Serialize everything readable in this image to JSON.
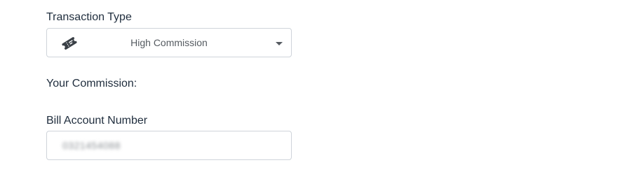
{
  "form": {
    "transaction_type": {
      "label": "Transaction Type",
      "selected": "High Commission",
      "icon": "ticket-icon"
    },
    "commission": {
      "label": "Your Commission:"
    },
    "bill_account": {
      "label": "Bill Account Number",
      "value": "0321454088"
    }
  }
}
